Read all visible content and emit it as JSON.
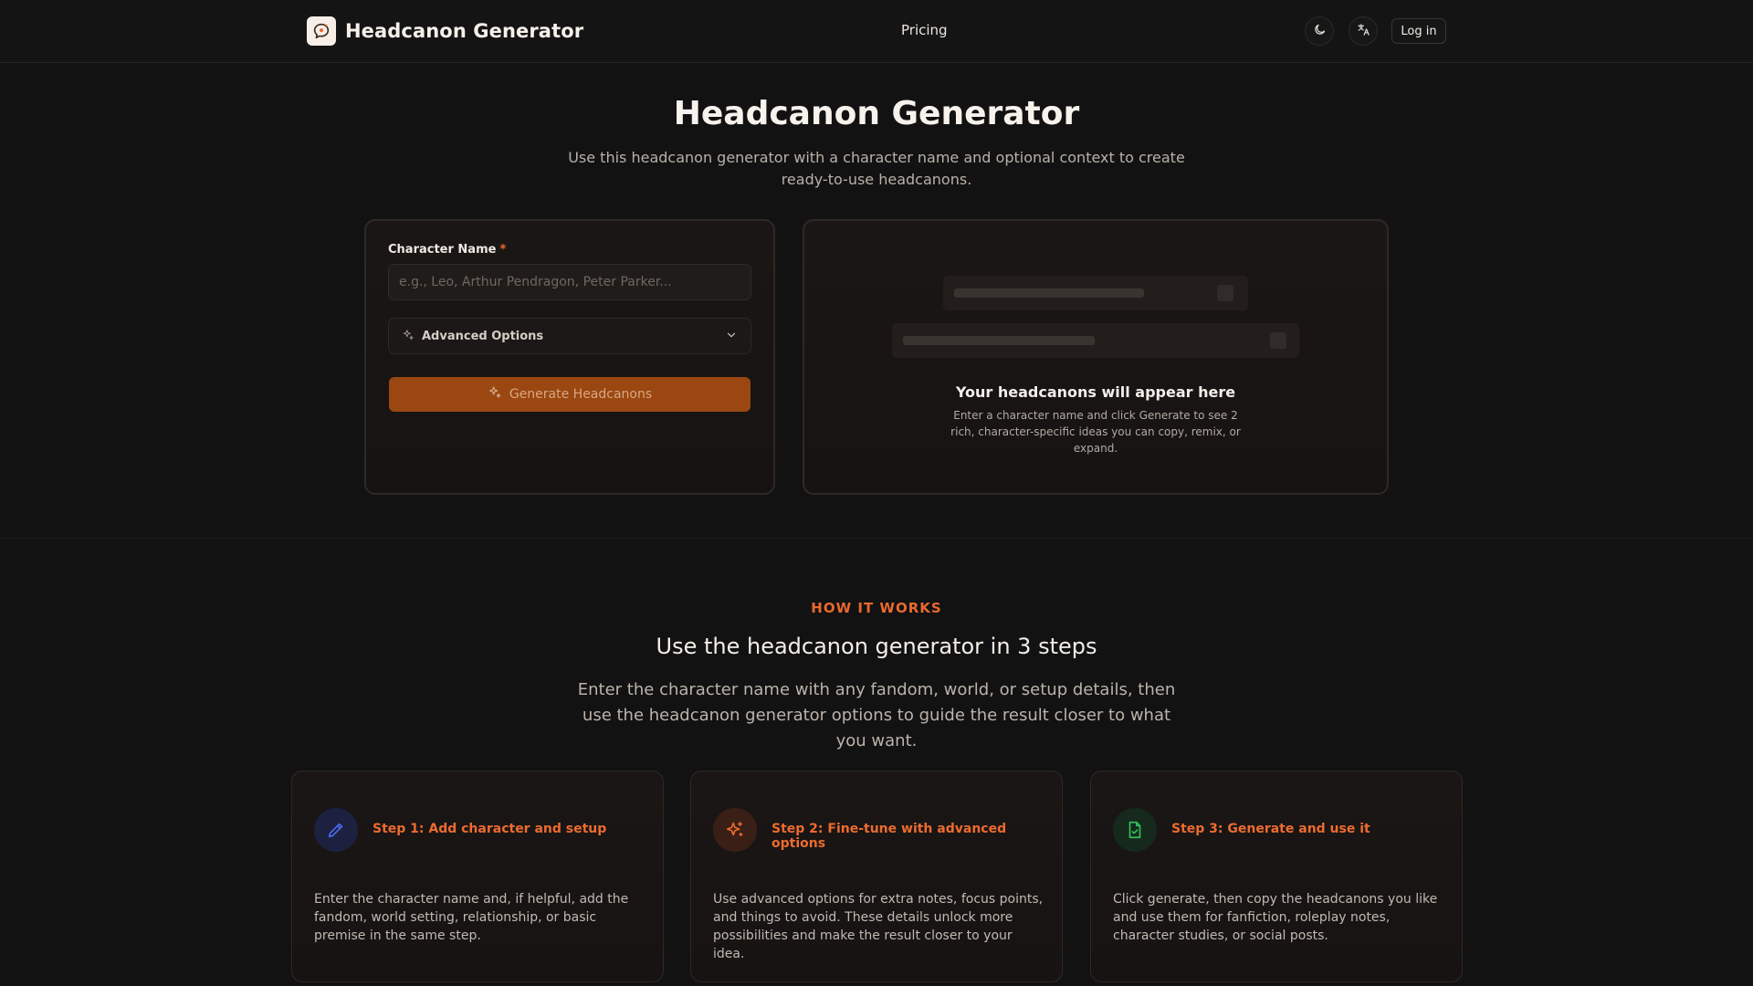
{
  "header": {
    "brand_name": "Headcanon Generator",
    "nav_pricing": "Pricing",
    "login_label": "Log in",
    "theme_icon": "moon-icon",
    "language_icon": "translate-icon",
    "logo_icon": "speech-bubble-icon"
  },
  "hero": {
    "title": "Headcanon Generator",
    "subtitle": "Use this headcanon generator with a character name and optional context to create ready-to-use headcanons."
  },
  "form": {
    "character_label": "Character Name",
    "required_mark": "*",
    "character_placeholder": "e.g., Leo, Arthur Pendragon, Peter Parker...",
    "character_value": "",
    "advanced_label": "Advanced Options",
    "generate_label": "Generate Headcanons"
  },
  "preview": {
    "title": "Your headcanons will appear here",
    "text": "Enter a character name and click Generate to see 2 rich, character-specific ideas you can copy, remix, or expand."
  },
  "how": {
    "eyebrow": "HOW IT WORKS",
    "title": "Use the headcanon generator in 3 steps",
    "subtitle": "Enter the character name with any fandom, world, or setup details, then use the headcanon generator options to guide the result closer to what you want.",
    "steps": [
      {
        "title": "Step 1: Add character and setup",
        "text": "Enter the character name and, if helpful, add the fandom, world setting, relationship, or basic premise in the same step.",
        "icon": "pencil-icon"
      },
      {
        "title": "Step 2: Fine-tune with advanced options",
        "text": "Use advanced options for extra notes, focus points, and things to avoid. These details unlock more possibilities and make the result closer to your idea.",
        "icon": "sparkles-icon"
      },
      {
        "title": "Step 3: Generate and use it",
        "text": "Click generate, then copy the headcanons you like and use them for fanfiction, roleplay notes, character studies, or social posts.",
        "icon": "file-check-icon"
      }
    ]
  },
  "colors": {
    "accent": "#ec6b2f",
    "button_bg": "#9a4711",
    "background": "#121212",
    "card_border": "#2f2925",
    "step1_icon": "#4a6cf0",
    "step2_icon": "#ec6b2f",
    "step3_icon": "#2fbf5a"
  }
}
